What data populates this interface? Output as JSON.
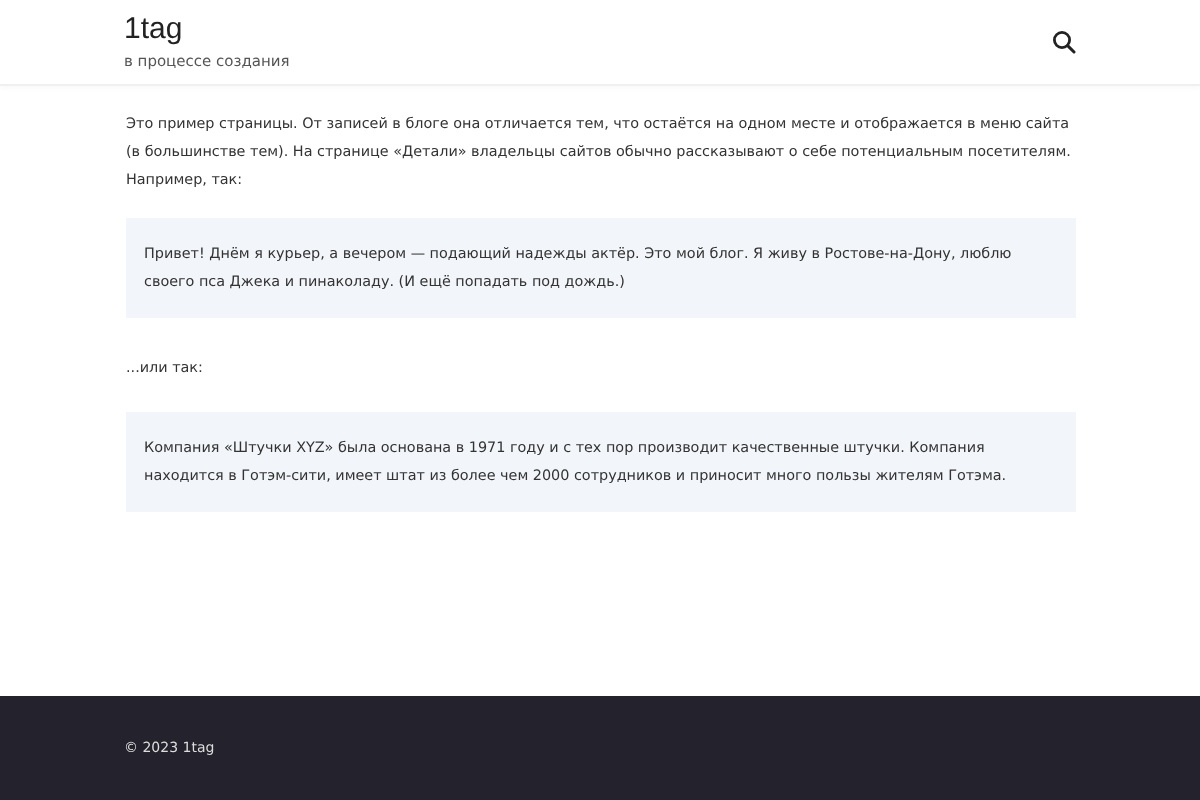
{
  "header": {
    "site_title": "1tag",
    "tagline": "в процессе создания"
  },
  "content": [
    {
      "kind": "paragraph",
      "text": "Это пример страницы. От записей в блоге она отличается тем, что остаётся на одном месте и отображается в меню сайта (в большинстве тем). На странице «Детали» владельцы сайтов обычно рассказывают о себе потенциальным посетителям. Например, так:"
    },
    {
      "kind": "quote",
      "text": "Привет! Днём я курьер, а вечером — подающий надежды актёр. Это мой блог. Я живу в Ростове-на-Дону, люблю своего пса Джека и пинаколаду. (И ещё попадать под дождь.)"
    },
    {
      "kind": "paragraph",
      "text": "...или так:"
    },
    {
      "kind": "quote",
      "text": "Компания «Штучки XYZ» была основана в 1971 году и с тех пор производит качественные штучки. Компания находится в Готэм-сити, имеет штат из более чем 2000 сотрудников и приносит много пользы жителям Готэма."
    }
  ],
  "footer": {
    "copyright": "© 2023 1tag"
  }
}
